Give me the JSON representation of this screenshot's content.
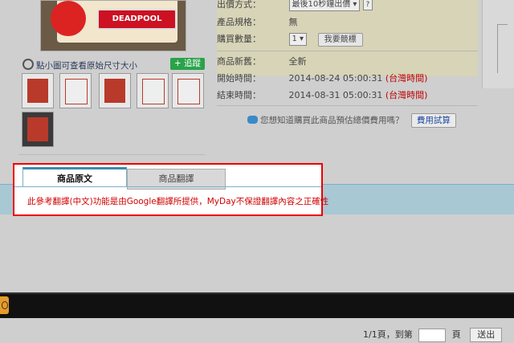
{
  "gallery": {
    "main_image_text": "DEADPOOL",
    "zoom_hint": "點小圖可查看原始尺寸大小",
    "track_button": "+ 追蹤"
  },
  "details": {
    "rows": [
      {
        "label": "出價方式：",
        "value": "最後10秒鐘出價"
      },
      {
        "label": "產品規格：",
        "value": "無"
      },
      {
        "label": "購買數量：",
        "value": "1",
        "button": "我要競標"
      },
      {
        "label": "商品新舊：",
        "value": "全新"
      },
      {
        "label": "開始時間：",
        "value": "2014-08-24 05:00:31",
        "tz": "(台灣時間)"
      },
      {
        "label": "結束時間：",
        "value": "2014-08-31 05:00:31",
        "tz": "(台灣時間)"
      }
    ],
    "help_icon": "?",
    "fee_question": "您想知道購買此商品預估總價費用嗎？",
    "fee_button": "費用試算"
  },
  "tabs": {
    "active": "商品原文",
    "inactive": "商品翻譯",
    "disclaimer": "此參考翻譯(中文)功能是由Google翻譯所提供，MyDay不保證翻譯內容之正確性"
  },
  "pager": {
    "info": "1/1頁，到第",
    "unit": "頁",
    "go_button": "送出"
  },
  "colors": {
    "highlight_border": "#e00000",
    "disclaimer_text": "#d00000",
    "tab_band": "#a8c8d4",
    "track_button": "#2aa34a"
  }
}
